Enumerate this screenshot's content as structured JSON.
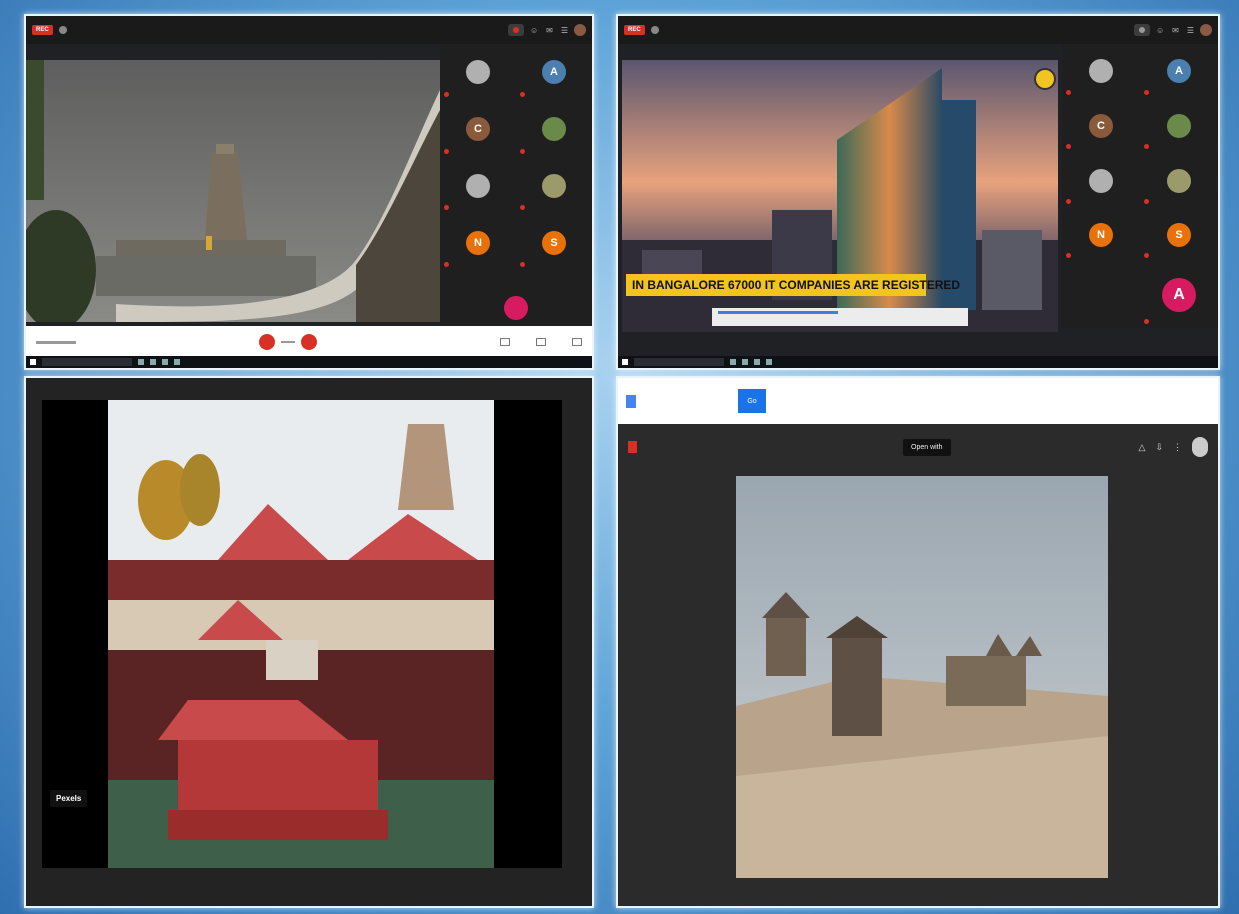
{
  "meet1": {
    "rec_label": "REC",
    "controls": {
      "end_call": "end-call",
      "mic": "mic-off"
    }
  },
  "meet2": {
    "banner_text": "IN BANGALORE 67000 IT COMPANIES ARE REGISTERED",
    "participants": [
      {
        "initial": "",
        "color": "#b0b0b0"
      },
      {
        "initial": "A",
        "color": "#4a7fb0"
      },
      {
        "initial": "C",
        "color": "#8a5a3c"
      },
      {
        "initial": "",
        "color": "#6a8a4a"
      },
      {
        "initial": "",
        "color": "#b0b0b0"
      },
      {
        "initial": "",
        "color": "#9a9a6a"
      },
      {
        "initial": "N",
        "color": "#e8710a"
      },
      {
        "initial": "S",
        "color": "#e8710a"
      }
    ],
    "presenter_initial": "A",
    "presenter_color": "#d81b60"
  },
  "meet1_participants": [
    {
      "initial": "",
      "color": "#b0b0b0"
    },
    {
      "initial": "A",
      "color": "#4a7fb0"
    },
    {
      "initial": "C",
      "color": "#8a5a3c"
    },
    {
      "initial": "",
      "color": "#6a8a4a"
    },
    {
      "initial": "",
      "color": "#b0b0b0"
    },
    {
      "initial": "",
      "color": "#9a9a6a"
    },
    {
      "initial": "N",
      "color": "#e8710a"
    },
    {
      "initial": "S",
      "color": "#e8710a"
    }
  ],
  "pexels": {
    "label": "Pexels"
  },
  "drive": {
    "go_label": "Go",
    "open_with": "Open with"
  },
  "colors": {
    "accent": "#1a73e8",
    "rec": "#d93025",
    "banner": "#f2c41f"
  }
}
